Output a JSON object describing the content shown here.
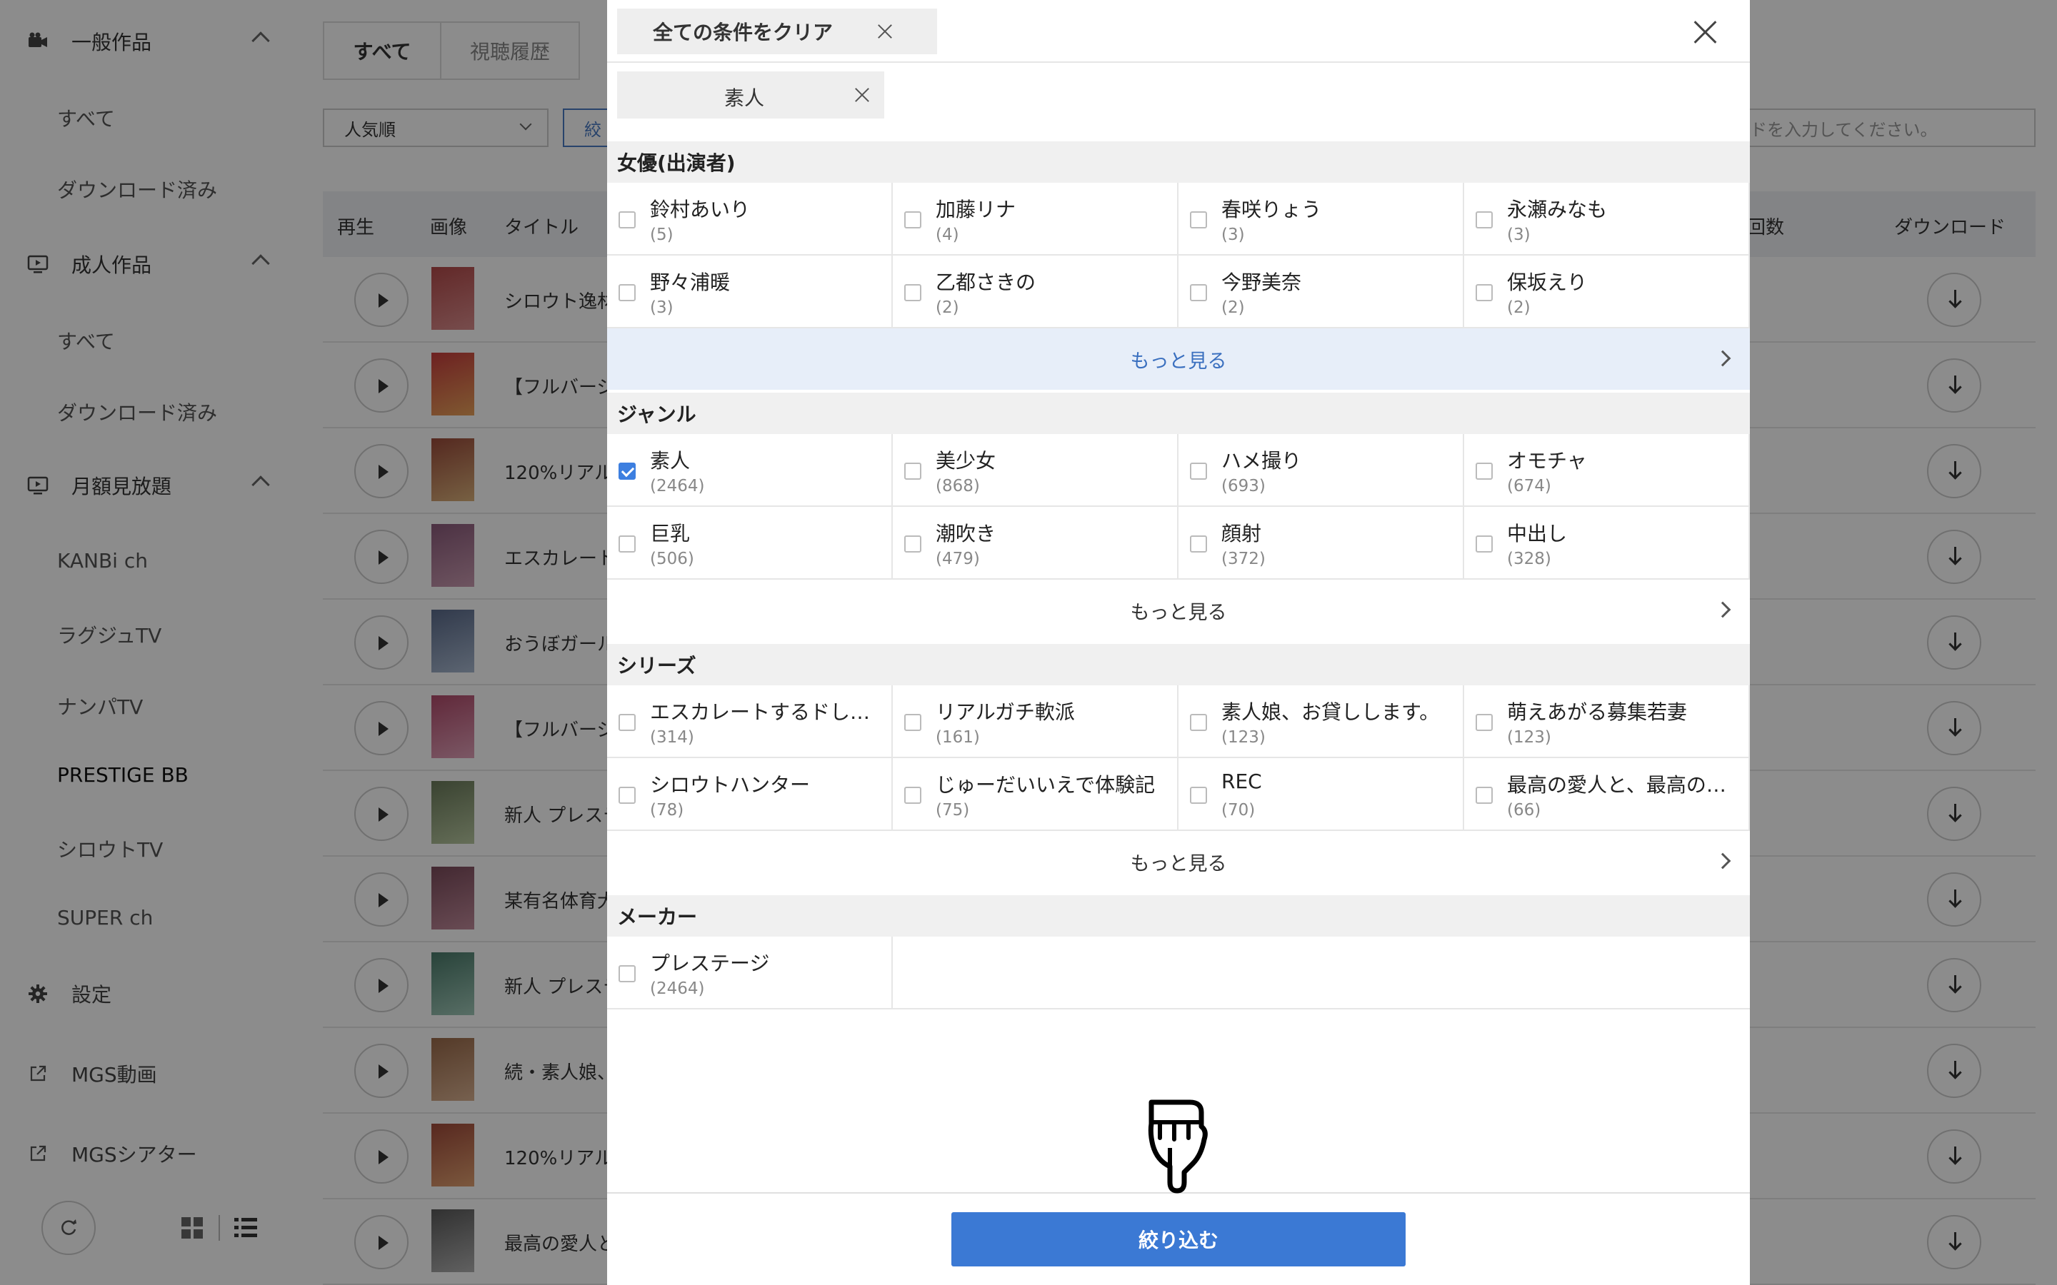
{
  "sidebar": {
    "sections": [
      {
        "label": "一般作品",
        "icon": "camera-icon"
      },
      {
        "label": "成人作品",
        "icon": "monitor-play-icon"
      },
      {
        "label": "月額見放題",
        "icon": "monitor-play-icon"
      }
    ],
    "general_items": [
      "すべて",
      "ダウンロード済み"
    ],
    "adult_items": [
      "すべて",
      "ダウンロード済み"
    ],
    "monthly_items": [
      "KANBi ch",
      "ラグジュTV",
      "ナンパTV",
      "PRESTIGE BB",
      "シロウトTV",
      "SUPER ch"
    ],
    "settings_label": "設定",
    "ext_links": [
      "MGS動画",
      "MGSシアター"
    ]
  },
  "main": {
    "tabs": [
      "すべて",
      "視聴履歴"
    ],
    "sort_value": "人気順",
    "filter_button": "絞",
    "search_placeholder": "ワードを入力してください。",
    "columns": {
      "play": "再生",
      "image": "画像",
      "title": "タイトル",
      "count": "回数",
      "download": "ダウンロード"
    },
    "rows": [
      "シロウト逸材",
      "【フルバージ",
      "120%リアル",
      "エスカレート",
      "おうぼガール",
      "【フルバージ",
      "新人 プレステ",
      "某有名体育大",
      "新人 プレステ",
      "続・素人娘、",
      "120%リアル",
      "最高の愛人と"
    ]
  },
  "modal": {
    "clear_all": "全ての条件をクリア",
    "active_filter": "素人",
    "categories": [
      {
        "title": "女優(出演者)",
        "options": [
          {
            "name": "鈴村あいり",
            "count": "(5)",
            "checked": false
          },
          {
            "name": "加藤リナ",
            "count": "(4)",
            "checked": false
          },
          {
            "name": "春咲りょう",
            "count": "(3)",
            "checked": false
          },
          {
            "name": "永瀬みなも",
            "count": "(3)",
            "checked": false
          },
          {
            "name": "野々浦暖",
            "count": "(3)",
            "checked": false
          },
          {
            "name": "乙都さきの",
            "count": "(2)",
            "checked": false
          },
          {
            "name": "今野美奈",
            "count": "(2)",
            "checked": false
          },
          {
            "name": "保坂えり",
            "count": "(2)",
            "checked": false
          }
        ],
        "more": "もっと見る"
      },
      {
        "title": "ジャンル",
        "options": [
          {
            "name": "素人",
            "count": "(2464)",
            "checked": true
          },
          {
            "name": "美少女",
            "count": "(868)",
            "checked": false
          },
          {
            "name": "ハメ撮り",
            "count": "(693)",
            "checked": false
          },
          {
            "name": "オモチャ",
            "count": "(674)",
            "checked": false
          },
          {
            "name": "巨乳",
            "count": "(506)",
            "checked": false
          },
          {
            "name": "潮吹き",
            "count": "(479)",
            "checked": false
          },
          {
            "name": "顔射",
            "count": "(372)",
            "checked": false
          },
          {
            "name": "中出し",
            "count": "(328)",
            "checked": false
          }
        ],
        "more": "もっと見る"
      },
      {
        "title": "シリーズ",
        "options": [
          {
            "name": "エスカレートするドし…",
            "count": "(314)",
            "checked": false
          },
          {
            "name": "リアルガチ軟派",
            "count": "(161)",
            "checked": false
          },
          {
            "name": "素人娘、お貸しします。",
            "count": "(123)",
            "checked": false
          },
          {
            "name": "萌えあがる募集若妻",
            "count": "(123)",
            "checked": false
          },
          {
            "name": "シロウトハンター",
            "count": "(78)",
            "checked": false
          },
          {
            "name": "じゅーだいいえで体験記",
            "count": "(75)",
            "checked": false
          },
          {
            "name": "REC",
            "count": "(70)",
            "checked": false
          },
          {
            "name": "最高の愛人と、最高の…",
            "count": "(66)",
            "checked": false
          }
        ],
        "more": "もっと見る"
      },
      {
        "title": "メーカー",
        "options": [
          {
            "name": "プレステージ",
            "count": "(2464)",
            "checked": false
          }
        ]
      }
    ],
    "apply_button": "絞り込む"
  },
  "colors": {
    "accent": "#3b79d4",
    "overlay": "rgba(0,0,0,0.45)",
    "more_highlight_bg": "#e7eef9"
  }
}
